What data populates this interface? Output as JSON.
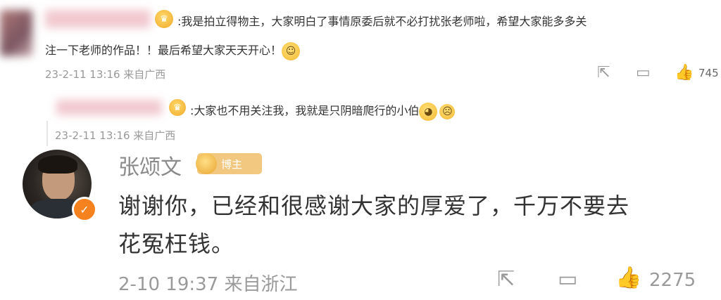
{
  "comment1": {
    "text_line1": ":我是拍立得物主，大家明白了事情原委后就不必打扰张老师啦，希望大家能多多关",
    "text_line2": "注一下老师的作品！！最后希望大家天天开心！",
    "meta": "23-2-11 13:16 来自广西",
    "like_count": "745"
  },
  "reply1": {
    "text": ":大家也不用关注我，我就是只阴暗爬行的小伯",
    "meta": "23-2-11 13:16 来自广西"
  },
  "comment2": {
    "author": "张颂文",
    "badge_label": "博主",
    "text_line1": "谢谢你，已经和很感谢大家的厚爱了，千万不要去",
    "text_line2": "花冤枉钱。",
    "meta": "2-10 19:37 来自浙江",
    "like_count": "2275"
  },
  "icons": {
    "share": "share-icon",
    "comment": "comment-icon",
    "like": "thumbs-up-icon",
    "crown": "crown-icon",
    "verified": "verified-icon"
  },
  "colors": {
    "accent_orange": "#f6821f",
    "badge_gold": "#f2c77f",
    "meta_gray": "#999999"
  }
}
